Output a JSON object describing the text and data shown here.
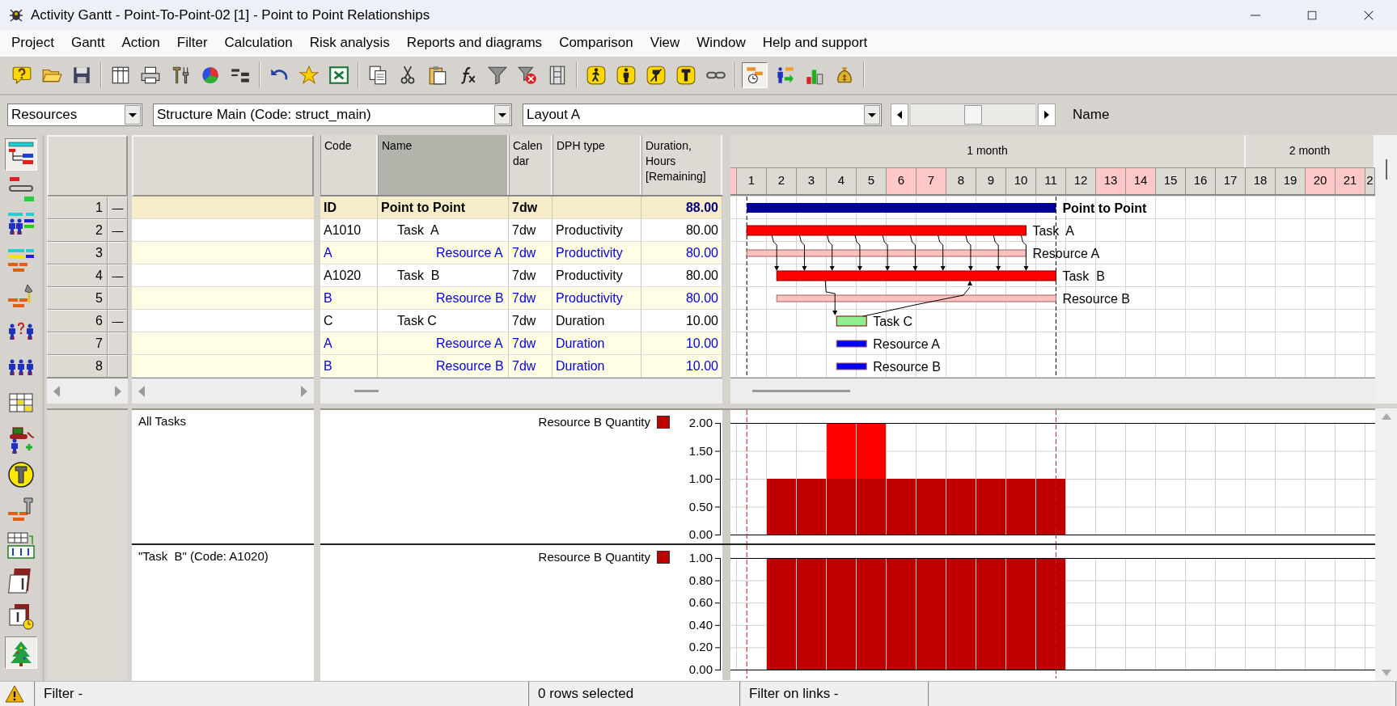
{
  "window": {
    "title": "Activity Gantt - Point-To-Point-02 [1] - Point to Point Relationships"
  },
  "menu": [
    "Project",
    "Gantt",
    "Action",
    "Filter",
    "Calculation",
    "Risk analysis",
    "Reports and diagrams",
    "Comparison",
    "View",
    "Window",
    "Help and support"
  ],
  "toolbar": {
    "groups": [
      [
        {
          "pressed": false
        },
        {
          "pressed": false
        },
        {
          "pressed": false
        }
      ],
      [
        {
          "pressed": false
        },
        {
          "pressed": false
        },
        {
          "pressed": false
        },
        {
          "pressed": false
        },
        {
          "pressed": false
        }
      ],
      [
        {
          "pressed": false
        },
        {
          "pressed": false
        },
        {
          "pressed": false
        }
      ],
      [
        {
          "pressed": false
        },
        {
          "pressed": false
        },
        {
          "pressed": false
        },
        {
          "pressed": false
        },
        {
          "pressed": false
        },
        {
          "pressed": false
        },
        {
          "pressed": false
        }
      ],
      [
        {
          "pressed": false
        },
        {
          "pressed": false
        },
        {
          "pressed": false
        },
        {
          "pressed": false
        },
        {
          "pressed": false
        }
      ],
      [
        {
          "pressed": true
        },
        {
          "pressed": false
        },
        {
          "pressed": false
        },
        {
          "pressed": false
        }
      ]
    ]
  },
  "selectors": [
    {
      "value": "Resources"
    },
    {
      "value": "Structure Main (Code: struct_main)"
    },
    {
      "value": "Layout A"
    }
  ],
  "zoom_slider": {
    "level": 0.5
  },
  "column_label": "Name",
  "side_tools": [
    {
      "pressed": true
    },
    {
      "pressed": false
    },
    {
      "pressed": false
    },
    {
      "pressed": false
    },
    {
      "pressed": false
    },
    {
      "pressed": false
    },
    {
      "pressed": false
    },
    {
      "pressed": false
    },
    {
      "pressed": false
    },
    {
      "pressed": false
    },
    {
      "pressed": false
    },
    {
      "pressed": false
    },
    {
      "pressed": false
    },
    {
      "pressed": false
    },
    {
      "pressed": true
    }
  ],
  "table": {
    "columns": [
      {
        "label": "Code",
        "selected": false
      },
      {
        "label": "Name",
        "selected": true
      },
      {
        "label": "Calendar",
        "selected": false
      },
      {
        "label": "DPH type",
        "selected": false
      },
      {
        "label": "Duration, Hours [Remaining]",
        "selected": false
      }
    ],
    "rows": [
      {
        "number": "1",
        "toggle": "—",
        "kind": "summary",
        "code": "ID",
        "name": "Point to Point",
        "calendar": "7dw",
        "duration": "88.00",
        "color": "#000099",
        "children": [
          {
            "number": "2",
            "toggle": "—",
            "kind": "task",
            "code": "A1010",
            "name": "Task  A",
            "calendar": "7dw",
            "dph_type": "Productivity",
            "duration": "80.00",
            "color": "#ff0000",
            "children": [
              {
                "number": "3",
                "kind": "resource",
                "code": "A",
                "name": "Resource A",
                "calendar": "7dw",
                "dph_type": "Productivity",
                "duration": "80.00",
                "color": "#ffc0c0"
              }
            ]
          },
          {
            "number": "4",
            "toggle": "—",
            "kind": "task",
            "code": "A1020",
            "name": "Task  B",
            "calendar": "7dw",
            "dph_type": "Productivity",
            "duration": "80.00",
            "color": "#ff0000",
            "children": [
              {
                "number": "5",
                "kind": "resource",
                "code": "B",
                "name": "Resource B",
                "calendar": "7dw",
                "dph_type": "Productivity",
                "duration": "80.00",
                "color": "#ffc0c0"
              }
            ]
          },
          {
            "number": "6",
            "toggle": "—",
            "kind": "task",
            "code": "C",
            "name": "Task C",
            "calendar": "7dw",
            "dph_type": "Duration",
            "duration": "10.00",
            "color": "#90ee90",
            "children": [
              {
                "number": "7",
                "kind": "resource",
                "code": "A",
                "name": "Resource A",
                "calendar": "7dw",
                "dph_type": "Duration",
                "duration": "10.00",
                "color": "#0000ff"
              },
              {
                "number": "8",
                "kind": "resource",
                "code": "B",
                "name": "Resource B",
                "calendar": "7dw",
                "dph_type": "Duration",
                "duration": "10.00",
                "color": "#0000ff"
              }
            ]
          }
        ]
      }
    ]
  },
  "timeline": {
    "months": [
      {
        "label": "1 month",
        "days": [
          {
            "weekend": true
          },
          {
            "label": "1",
            "weekend": false
          },
          {
            "label": "2",
            "weekend": false
          },
          {
            "label": "3",
            "weekend": false
          },
          {
            "label": "4",
            "weekend": false
          },
          {
            "label": "5",
            "weekend": false
          },
          {
            "label": "6",
            "weekend": true
          },
          {
            "label": "7",
            "weekend": true
          },
          {
            "label": "8",
            "weekend": false
          },
          {
            "label": "9",
            "weekend": false
          },
          {
            "label": "10",
            "weekend": false
          },
          {
            "label": "11",
            "weekend": false
          },
          {
            "label": "12",
            "weekend": false
          },
          {
            "label": "13",
            "weekend": true
          },
          {
            "label": "14",
            "weekend": true
          },
          {
            "label": "15",
            "weekend": false
          },
          {
            "label": "16",
            "weekend": false
          },
          {
            "label": "17",
            "weekend": false
          }
        ]
      },
      {
        "label": "2 month",
        "days": [
          {
            "label": "18",
            "weekend": false
          },
          {
            "label": "19",
            "weekend": false
          },
          {
            "label": "20",
            "weekend": true
          },
          {
            "label": "21",
            "weekend": true
          },
          {
            "label": "2",
            "weekend": false
          }
        ]
      }
    ]
  },
  "gantt": {
    "bar_labels": [
      "Point to Point",
      "Task  A",
      "Resource A",
      "Task  B",
      "Resource B",
      "Task C",
      "Resource A",
      "Resource B"
    ]
  },
  "histograms": [
    {
      "scope": "All Tasks",
      "chart_data": {
        "type": "bar",
        "stacked": true,
        "grid": true,
        "ylim": [
          0,
          2
        ],
        "yticks": [
          {
            "value": 0,
            "label": "0.00"
          },
          {
            "value": 0.5,
            "label": "0.50"
          },
          {
            "value": 1,
            "label": "1.00"
          },
          {
            "value": 1.5,
            "label": "1.50"
          },
          {
            "value": 2,
            "label": "2.00"
          }
        ],
        "series": [
          {
            "name": "Resource B Quantity",
            "color": "#c00000",
            "values": [
              0,
              1,
              1,
              1,
              1,
              1,
              1,
              1,
              1,
              1,
              1,
              0,
              0,
              0,
              0,
              0,
              0,
              0,
              0,
              0,
              0,
              0
            ]
          },
          {
            "color": "#ff0000",
            "values": [
              0,
              0,
              0,
              1,
              1,
              0,
              0,
              0,
              0,
              0,
              0,
              0,
              0,
              0,
              0,
              0,
              0,
              0,
              0,
              0,
              0,
              0
            ]
          }
        ]
      }
    },
    {
      "scope": "\"Task  B\" (Code: A1020)",
      "chart_data": {
        "type": "bar",
        "stacked": true,
        "grid": true,
        "ylim": [
          0,
          1
        ],
        "yticks": [
          {
            "value": 0,
            "label": "0.00"
          },
          {
            "value": 0.2,
            "label": "0.20"
          },
          {
            "value": 0.4,
            "label": "0.40"
          },
          {
            "value": 0.6,
            "label": "0.60"
          },
          {
            "value": 0.8,
            "label": "0.80"
          },
          {
            "value": 1,
            "label": "1.00"
          }
        ],
        "series": [
          {
            "name": "Resource B Quantity",
            "color": "#c00000",
            "values": [
              0,
              1,
              1,
              1,
              1,
              1,
              1,
              1,
              1,
              1,
              1,
              0,
              0,
              0,
              0,
              0,
              0,
              0,
              0,
              0,
              0,
              0
            ]
          }
        ]
      }
    }
  ],
  "status_bar": [
    "Filter -",
    "0 rows selected",
    "Filter on links -"
  ]
}
